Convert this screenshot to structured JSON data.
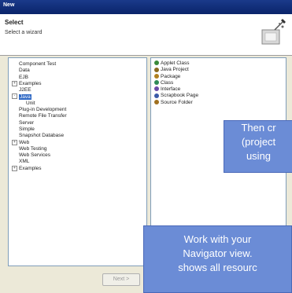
{
  "window": {
    "title": "New"
  },
  "header": {
    "title": "Select",
    "subtitle": "Select a wizard"
  },
  "tree": {
    "items": [
      {
        "label": "Component Test",
        "indent": 1
      },
      {
        "label": "Data",
        "indent": 1
      },
      {
        "label": "EJB",
        "indent": 1
      },
      {
        "label": "Examples",
        "indent": 0,
        "expander": "+"
      },
      {
        "label": "J2EE",
        "indent": 1
      },
      {
        "label": "Java",
        "indent": 0,
        "expander": "-",
        "selected": true
      },
      {
        "label": "Unit",
        "indent": 2
      },
      {
        "label": "Plug-in Development",
        "indent": 1
      },
      {
        "label": "Remote File Transfer",
        "indent": 1
      },
      {
        "label": "Server",
        "indent": 1
      },
      {
        "label": "Simple",
        "indent": 1
      },
      {
        "label": "Snapshot Database",
        "indent": 1
      },
      {
        "label": "Web",
        "indent": 0,
        "expander": "+"
      },
      {
        "label": "Web Testing",
        "indent": 1
      },
      {
        "label": "Web Services",
        "indent": 1
      },
      {
        "label": "XML",
        "indent": 1
      },
      {
        "label": "Examples",
        "indent": 0,
        "expander": "+"
      }
    ]
  },
  "wizards": {
    "items": [
      {
        "label": "Applet Class",
        "color": "#3a8a3a"
      },
      {
        "label": "Java Project",
        "color": "#8a6a20"
      },
      {
        "label": "Package",
        "color": "#b08020"
      },
      {
        "label": "Class",
        "color": "#2e8b57"
      },
      {
        "label": "Interface",
        "color": "#6a4aa8"
      },
      {
        "label": "Scrapbook Page",
        "color": "#3a5aa8"
      },
      {
        "label": "Source Folder",
        "color": "#a07020"
      }
    ]
  },
  "callouts": {
    "top": {
      "lines": [
        "Then cr",
        "(project",
        "using"
      ]
    },
    "bottom": {
      "lines": [
        "Work with your",
        "Navigator view.",
        "shows all resourc"
      ]
    }
  },
  "buttons": {
    "next": "Next >"
  },
  "colors": {
    "selection": "#316ac5",
    "callout": "#6b8cd6",
    "titlebar": "#0a246a"
  }
}
